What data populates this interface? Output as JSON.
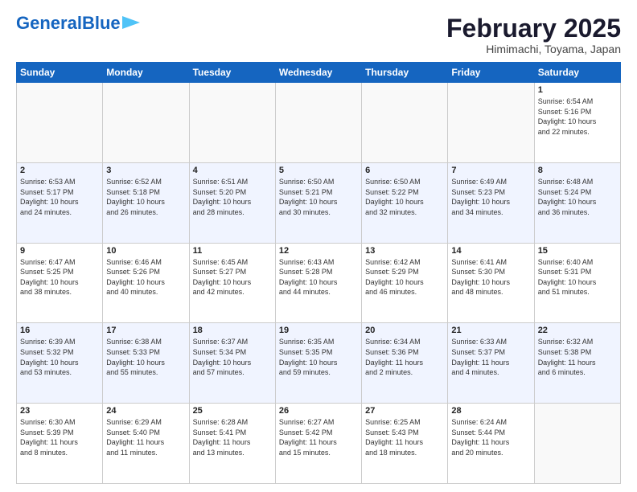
{
  "logo": {
    "part1": "General",
    "part2": "Blue"
  },
  "title": "February 2025",
  "subtitle": "Himimachi, Toyama, Japan",
  "weekdays": [
    "Sunday",
    "Monday",
    "Tuesday",
    "Wednesday",
    "Thursday",
    "Friday",
    "Saturday"
  ],
  "rows": [
    [
      {
        "day": "",
        "info": ""
      },
      {
        "day": "",
        "info": ""
      },
      {
        "day": "",
        "info": ""
      },
      {
        "day": "",
        "info": ""
      },
      {
        "day": "",
        "info": ""
      },
      {
        "day": "",
        "info": ""
      },
      {
        "day": "1",
        "info": "Sunrise: 6:54 AM\nSunset: 5:16 PM\nDaylight: 10 hours\nand 22 minutes."
      }
    ],
    [
      {
        "day": "2",
        "info": "Sunrise: 6:53 AM\nSunset: 5:17 PM\nDaylight: 10 hours\nand 24 minutes."
      },
      {
        "day": "3",
        "info": "Sunrise: 6:52 AM\nSunset: 5:18 PM\nDaylight: 10 hours\nand 26 minutes."
      },
      {
        "day": "4",
        "info": "Sunrise: 6:51 AM\nSunset: 5:20 PM\nDaylight: 10 hours\nand 28 minutes."
      },
      {
        "day": "5",
        "info": "Sunrise: 6:50 AM\nSunset: 5:21 PM\nDaylight: 10 hours\nand 30 minutes."
      },
      {
        "day": "6",
        "info": "Sunrise: 6:50 AM\nSunset: 5:22 PM\nDaylight: 10 hours\nand 32 minutes."
      },
      {
        "day": "7",
        "info": "Sunrise: 6:49 AM\nSunset: 5:23 PM\nDaylight: 10 hours\nand 34 minutes."
      },
      {
        "day": "8",
        "info": "Sunrise: 6:48 AM\nSunset: 5:24 PM\nDaylight: 10 hours\nand 36 minutes."
      }
    ],
    [
      {
        "day": "9",
        "info": "Sunrise: 6:47 AM\nSunset: 5:25 PM\nDaylight: 10 hours\nand 38 minutes."
      },
      {
        "day": "10",
        "info": "Sunrise: 6:46 AM\nSunset: 5:26 PM\nDaylight: 10 hours\nand 40 minutes."
      },
      {
        "day": "11",
        "info": "Sunrise: 6:45 AM\nSunset: 5:27 PM\nDaylight: 10 hours\nand 42 minutes."
      },
      {
        "day": "12",
        "info": "Sunrise: 6:43 AM\nSunset: 5:28 PM\nDaylight: 10 hours\nand 44 minutes."
      },
      {
        "day": "13",
        "info": "Sunrise: 6:42 AM\nSunset: 5:29 PM\nDaylight: 10 hours\nand 46 minutes."
      },
      {
        "day": "14",
        "info": "Sunrise: 6:41 AM\nSunset: 5:30 PM\nDaylight: 10 hours\nand 48 minutes."
      },
      {
        "day": "15",
        "info": "Sunrise: 6:40 AM\nSunset: 5:31 PM\nDaylight: 10 hours\nand 51 minutes."
      }
    ],
    [
      {
        "day": "16",
        "info": "Sunrise: 6:39 AM\nSunset: 5:32 PM\nDaylight: 10 hours\nand 53 minutes."
      },
      {
        "day": "17",
        "info": "Sunrise: 6:38 AM\nSunset: 5:33 PM\nDaylight: 10 hours\nand 55 minutes."
      },
      {
        "day": "18",
        "info": "Sunrise: 6:37 AM\nSunset: 5:34 PM\nDaylight: 10 hours\nand 57 minutes."
      },
      {
        "day": "19",
        "info": "Sunrise: 6:35 AM\nSunset: 5:35 PM\nDaylight: 10 hours\nand 59 minutes."
      },
      {
        "day": "20",
        "info": "Sunrise: 6:34 AM\nSunset: 5:36 PM\nDaylight: 11 hours\nand 2 minutes."
      },
      {
        "day": "21",
        "info": "Sunrise: 6:33 AM\nSunset: 5:37 PM\nDaylight: 11 hours\nand 4 minutes."
      },
      {
        "day": "22",
        "info": "Sunrise: 6:32 AM\nSunset: 5:38 PM\nDaylight: 11 hours\nand 6 minutes."
      }
    ],
    [
      {
        "day": "23",
        "info": "Sunrise: 6:30 AM\nSunset: 5:39 PM\nDaylight: 11 hours\nand 8 minutes."
      },
      {
        "day": "24",
        "info": "Sunrise: 6:29 AM\nSunset: 5:40 PM\nDaylight: 11 hours\nand 11 minutes."
      },
      {
        "day": "25",
        "info": "Sunrise: 6:28 AM\nSunset: 5:41 PM\nDaylight: 11 hours\nand 13 minutes."
      },
      {
        "day": "26",
        "info": "Sunrise: 6:27 AM\nSunset: 5:42 PM\nDaylight: 11 hours\nand 15 minutes."
      },
      {
        "day": "27",
        "info": "Sunrise: 6:25 AM\nSunset: 5:43 PM\nDaylight: 11 hours\nand 18 minutes."
      },
      {
        "day": "28",
        "info": "Sunrise: 6:24 AM\nSunset: 5:44 PM\nDaylight: 11 hours\nand 20 minutes."
      },
      {
        "day": "",
        "info": ""
      }
    ]
  ]
}
